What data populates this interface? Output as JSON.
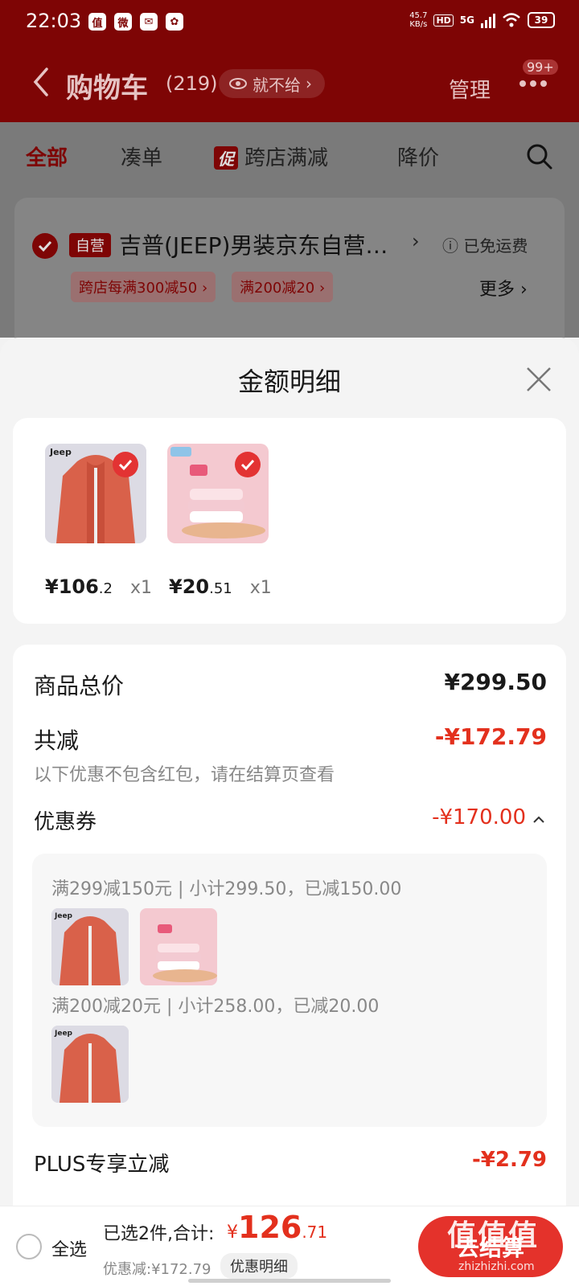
{
  "status_bar": {
    "time": "22:03",
    "net_speed_value": "45.7",
    "net_speed_unit": "KB/s",
    "hd": "HD",
    "network": "5G",
    "battery": "39"
  },
  "navbar": {
    "title": "购物车",
    "count": "(219)",
    "private_label": "就不给",
    "manage": "管理",
    "badge": "99+"
  },
  "tabs": {
    "all": "全部",
    "bundle": "凑单",
    "promo_tag": "促",
    "cross_store": "跨店满减",
    "price_drop": "降价"
  },
  "store": {
    "self_tag": "自营",
    "name": "吉普(JEEP)男装京东自营旗舰店",
    "free_shipping": "已免运费",
    "coupons": [
      "跨店每满300减50 ›",
      "满200减20 ›"
    ],
    "more": "更多 ›"
  },
  "sheet": {
    "title": "金额明细",
    "items": [
      {
        "name": "jacket",
        "price_int": "¥106",
        "price_dec": ".2",
        "qty": "x1"
      },
      {
        "name": "underwear-pack",
        "price_int": "¥20",
        "price_dec": ".51",
        "qty": "x1"
      }
    ],
    "total_label": "商品总价",
    "total_value": "¥299.50",
    "reduction_label": "共减",
    "reduction_value": "-¥172.79",
    "reduction_note": "以下优惠不包含红包，请在结算页查看",
    "coupon_label": "优惠券",
    "coupon_value": "-¥170.00",
    "coupon_lines": [
      "满299减150元 | 小计299.50，已减150.00",
      "满200减20元 | 小计258.00，已减20.00"
    ],
    "plus_label": "PLUS专享立减",
    "plus_value": "-¥2.79"
  },
  "bottom": {
    "select_all": "全选",
    "summary": "已选2件,合计:",
    "currency": "¥",
    "total_int": "126",
    "total_dec": ".71",
    "discount": "优惠减:¥172.79",
    "detail_btn": "优惠明细",
    "checkout": "去结算"
  },
  "watermark": {
    "text": "值值值",
    "site": "zhizhizhi.com"
  },
  "colors": {
    "brand_red": "#e3301d",
    "dim_header": "#7e0505",
    "checkout": "#e4322b"
  }
}
